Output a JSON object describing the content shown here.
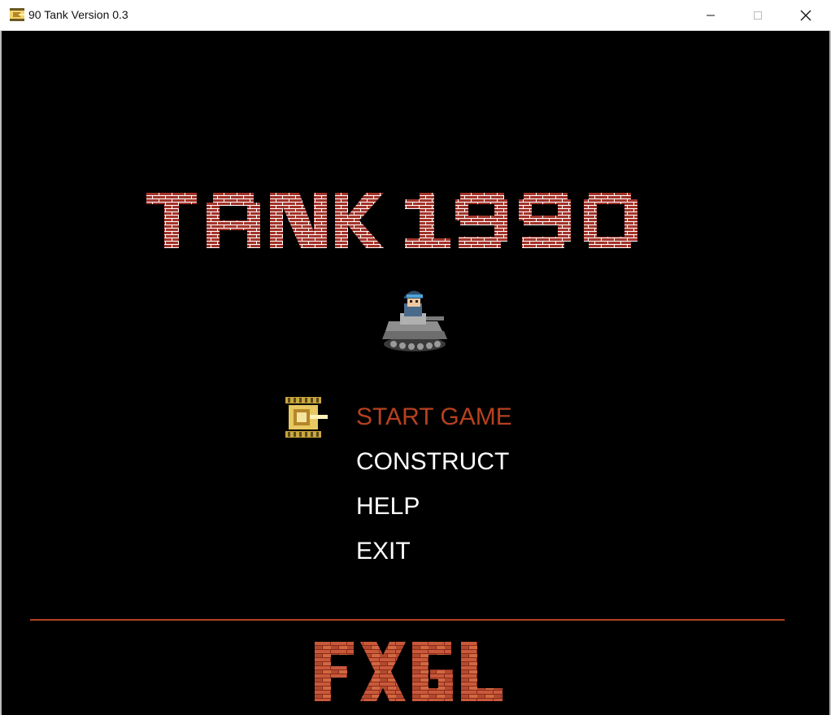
{
  "window": {
    "title": "90 Tank Version 0.3",
    "controls": [
      "minimize",
      "maximize",
      "close"
    ]
  },
  "logo": {
    "text": "TANK 1990",
    "style": "red brick letters"
  },
  "menu": {
    "selected_index": 0,
    "items": [
      {
        "label": "START GAME"
      },
      {
        "label": "CONSTRUCT"
      },
      {
        "label": "HELP"
      },
      {
        "label": "EXIT"
      }
    ]
  },
  "footer": {
    "engine_logo": "FXGL"
  },
  "colors": {
    "background": "#000000",
    "accent": "#b6411f",
    "brick": "#a3342a",
    "mortar": "#ffffff",
    "menu_text": "#ffffff"
  },
  "icons": [
    "app-tank-icon",
    "soldier-tank-sprite",
    "menu-cursor-tank-icon"
  ]
}
